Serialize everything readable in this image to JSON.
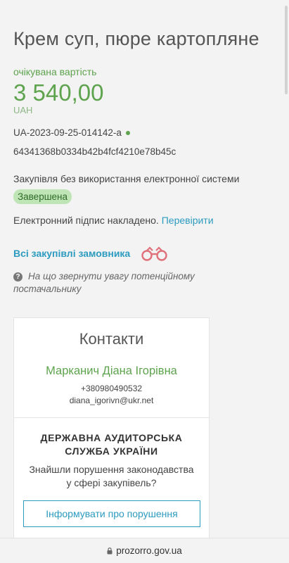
{
  "tender": {
    "title": "Крем суп, пюре картопляне",
    "expected_cost_label": "очікувана вартість",
    "amount": "3 540,00",
    "currency": "UAH",
    "id": "UA-2023-09-25-014142-a",
    "hash": "64341368b0334b42b4fcf4210e78b45c",
    "procurement_type": "Закупівля без використання електронної системи",
    "status": "Завершена",
    "signature_text": "Електронний підпис накладено.",
    "verify_link": "Перевірити",
    "all_procurements_link": "Всі закупівлі замовника",
    "attention_text": "На що звернути увагу потенційному постачальнику"
  },
  "contacts": {
    "title": "Контакти",
    "name": "Марканич Діана Ігорівна",
    "phone": "+380980490532",
    "email": "diana_igorivn@ukr.net"
  },
  "audit": {
    "title_line1": "ДЕРЖАВНА АУДИТОРСЬКА",
    "title_line2": "СЛУЖБА УКРАЇНИ",
    "question_line1": "Знайшли порушення законодавства",
    "question_line2": "у сфері закупівель?",
    "report_button": "Інформувати про порушення"
  },
  "browser": {
    "url": "prozorro.gov.ua"
  },
  "colors": {
    "accent_green": "#5ea34e",
    "link_blue": "#2c9bbf",
    "badge_bg": "#bfe5b6"
  },
  "icons": [
    "binoculars-icon",
    "question-icon",
    "lock-icon",
    "status-dot-icon"
  ]
}
